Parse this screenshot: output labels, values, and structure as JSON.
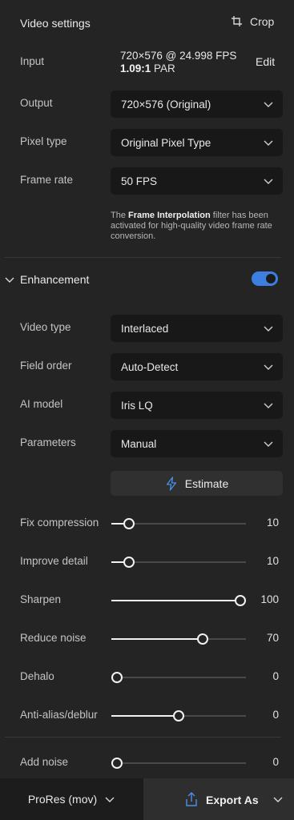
{
  "header": {
    "title": "Video settings",
    "crop_label": "Crop"
  },
  "input": {
    "label": "Input",
    "resolution": "720×576 @ 24.998 FPS",
    "par_value": "1.09:1",
    "par_unit": "PAR",
    "edit_label": "Edit"
  },
  "output": {
    "label": "Output",
    "value": "720×576 (Original)"
  },
  "pixel_type": {
    "label": "Pixel type",
    "value": "Original Pixel Type"
  },
  "frame_rate": {
    "label": "Frame rate",
    "value": "50 FPS"
  },
  "note": {
    "pre": "The ",
    "bold": "Frame Interpolation",
    "post": " filter has been activated for high-quality video frame rate conversion."
  },
  "enhancement": {
    "title": "Enhancement",
    "toggle_on": true,
    "accent_color": "#3d7fe0",
    "video_type": {
      "label": "Video type",
      "value": "Interlaced"
    },
    "field_order": {
      "label": "Field order",
      "value": "Auto-Detect"
    },
    "ai_model": {
      "label": "AI model",
      "value": "Iris LQ"
    },
    "parameters": {
      "label": "Parameters",
      "value": "Manual"
    },
    "estimate_label": "Estimate",
    "sliders": [
      {
        "label": "Fix compression",
        "value": "10",
        "fraction": 0.13
      },
      {
        "label": "Improve detail",
        "value": "10",
        "fraction": 0.13
      },
      {
        "label": "Sharpen",
        "value": "100",
        "fraction": 0.96
      },
      {
        "label": "Reduce noise",
        "value": "70",
        "fraction": 0.68
      },
      {
        "label": "Dehalo",
        "value": "0",
        "fraction": 0.04
      },
      {
        "label": "Anti-alias/deblur",
        "value": "0",
        "fraction": 0.5
      }
    ],
    "add_noise": {
      "label": "Add noise",
      "value": "0",
      "fraction": 0.04
    }
  },
  "footer": {
    "format": "ProRes (mov)",
    "export_label": "Export As"
  }
}
